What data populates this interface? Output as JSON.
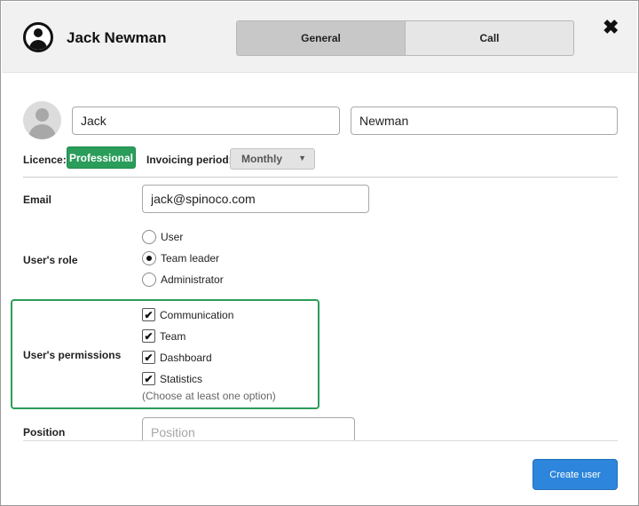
{
  "header": {
    "user_name": "Jack Newman",
    "tabs": [
      {
        "label": "General",
        "active": true
      },
      {
        "label": "Call",
        "active": false
      }
    ],
    "close_glyph": "✖"
  },
  "form": {
    "first_name": {
      "value": "Jack"
    },
    "last_name": {
      "value": "Newman"
    },
    "licence": {
      "label": "Licence:",
      "value": "Professional",
      "color": "#2a9d5a"
    },
    "invoicing": {
      "label": "Invoicing period:",
      "value": "Monthly"
    },
    "email": {
      "label": "Email",
      "value": "jack@spinoco.com"
    },
    "role": {
      "label": "User's role",
      "options": [
        {
          "label": "User",
          "checked": false
        },
        {
          "label": "Team leader",
          "checked": true
        },
        {
          "label": "Administrator",
          "checked": false
        }
      ]
    },
    "permissions": {
      "label": "User's permissions",
      "options": [
        {
          "label": "Communication",
          "checked": true
        },
        {
          "label": "Team",
          "checked": true
        },
        {
          "label": "Dashboard",
          "checked": true
        },
        {
          "label": "Statistics",
          "checked": true
        }
      ],
      "hint": "(Choose at least one option)",
      "highlight_color": "#2a9d5a"
    },
    "position": {
      "label": "Position",
      "placeholder": "Position",
      "value": ""
    }
  },
  "footer": {
    "create_label": "Create user",
    "accent_color": "#2d86db"
  },
  "icons": {
    "header_avatar": "user-circle-icon",
    "user_avatar": "avatar-placeholder-icon",
    "close": "close-icon",
    "dropdown": "chevron-down-icon",
    "check": "checkmark-icon"
  }
}
